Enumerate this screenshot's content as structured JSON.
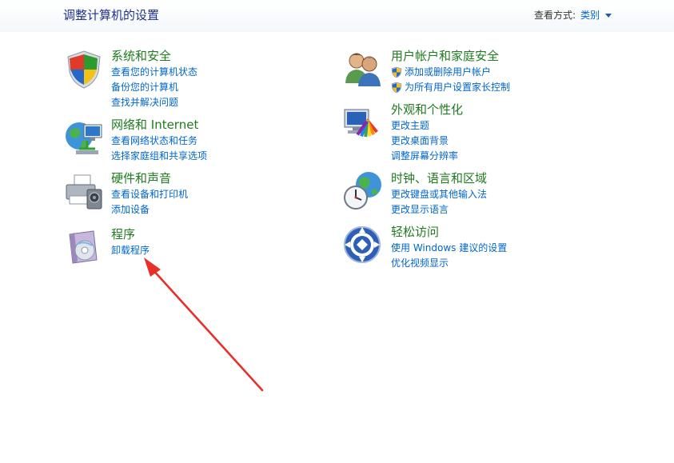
{
  "header": {
    "title": "调整计算机的设置",
    "view_by_label": "查看方式:",
    "view_by_value": "类别"
  },
  "categories": {
    "system_security": {
      "title": "系统和安全",
      "icon": "shield-flag-icon",
      "links": [
        "查看您的计算机状态",
        "备份您的计算机",
        "查找并解决问题"
      ]
    },
    "network": {
      "title": "网络和 Internet",
      "icon": "globe-network-icon",
      "links": [
        "查看网络状态和任务",
        "选择家庭组和共享选项"
      ]
    },
    "hardware": {
      "title": "硬件和声音",
      "icon": "printer-speaker-icon",
      "links": [
        "查看设备和打印机",
        "添加设备"
      ]
    },
    "programs": {
      "title": "程序",
      "icon": "program-disc-icon",
      "links": [
        "卸载程序"
      ]
    },
    "user_accounts": {
      "title": "用户帐户和家庭安全",
      "icon": "users-icon",
      "links": [
        "添加或删除用户帐户",
        "为所有用户设置家长控制"
      ]
    },
    "appearance": {
      "title": "外观和个性化",
      "icon": "monitor-palette-icon",
      "links": [
        "更改主题",
        "更改桌面背景",
        "调整屏幕分辨率"
      ]
    },
    "clock_region": {
      "title": "时钟、语言和区域",
      "icon": "clock-globe-icon",
      "links": [
        "更改键盘或其他输入法",
        "更改显示语言"
      ]
    },
    "ease_access": {
      "title": "轻松访问",
      "icon": "ease-of-access-icon",
      "links": [
        "使用 Windows 建议的设置",
        "优化视频显示"
      ]
    }
  },
  "colors": {
    "title_blue": "#1e3287",
    "category_green": "#1e7b1e",
    "link_blue": "#0066cc",
    "annotation_red": "#e8302a"
  }
}
